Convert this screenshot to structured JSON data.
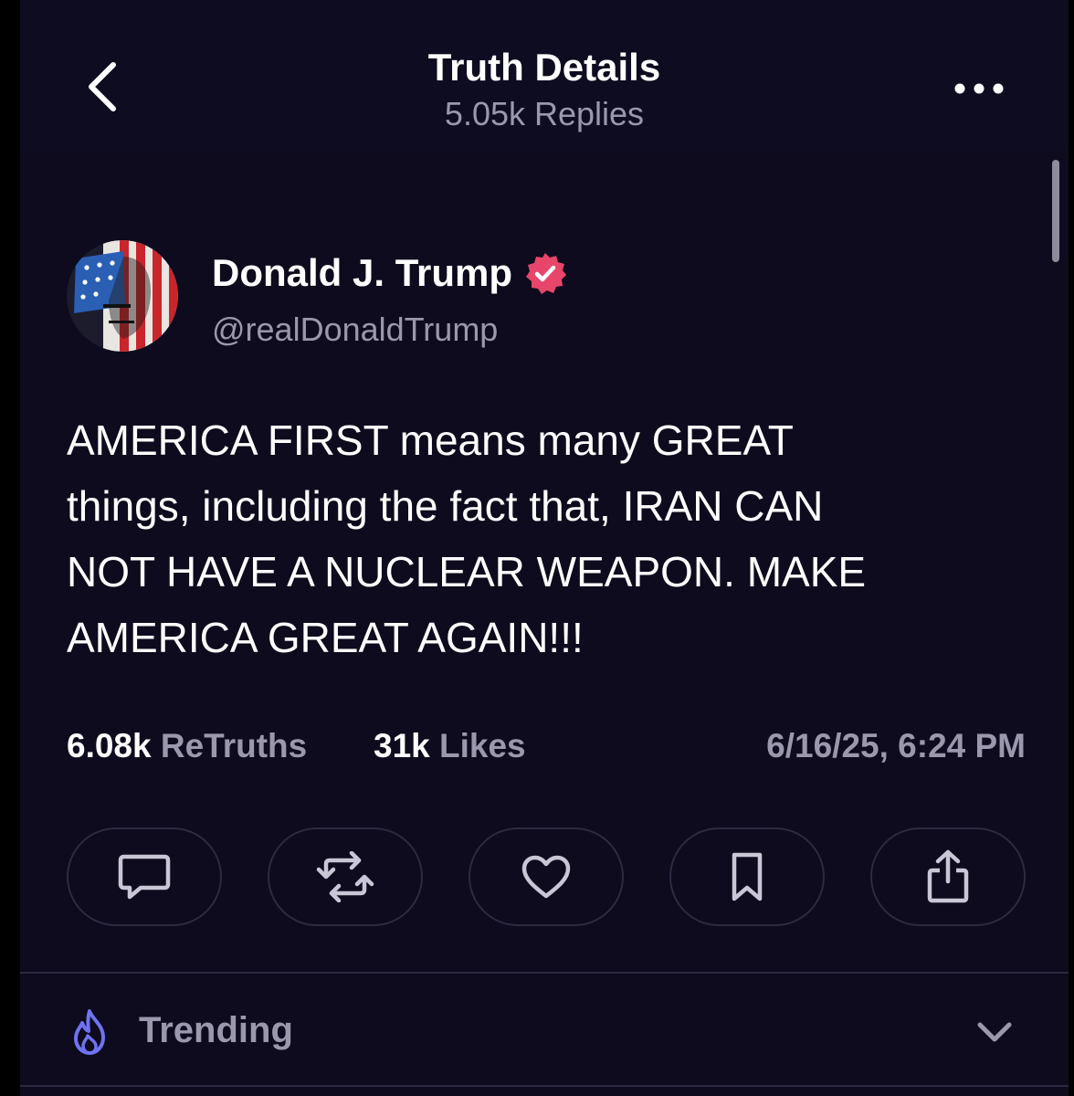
{
  "header": {
    "title": "Truth Details",
    "subtitle": "5.05k Replies",
    "back_icon": "chevron-left-icon",
    "more_icon": "ellipsis-icon"
  },
  "post": {
    "author_name": "Donald J. Trump",
    "verified_icon": "verified-badge-icon",
    "handle": "@realDonaldTrump",
    "text": "AMERICA FIRST means many GREAT\nthings, including the fact that, IRAN CAN\nNOT HAVE A NUCLEAR WEAPON. MAKE\nAMERICA GREAT AGAIN!!!",
    "retruths_count": "6.08k",
    "retruths_label": "ReTruths",
    "likes_count": "31k",
    "likes_label": "Likes",
    "timestamp": "6/16/25, 6:24 PM"
  },
  "actions": [
    {
      "name": "reply",
      "icon": "comment-icon"
    },
    {
      "name": "retruth",
      "icon": "repost-icon"
    },
    {
      "name": "like",
      "icon": "heart-icon"
    },
    {
      "name": "bookmark",
      "icon": "bookmark-icon"
    },
    {
      "name": "share",
      "icon": "share-icon"
    }
  ],
  "trending": {
    "label": "Trending",
    "icon": "flame-icon",
    "toggle_icon": "chevron-down-icon"
  },
  "colors": {
    "background": "#0d0b1d",
    "text_primary": "#ffffff",
    "text_secondary": "#9b98ad",
    "verified_badge": "#e8456a",
    "trending_icon": "#6f73f2",
    "button_border": "#2d2a42"
  }
}
